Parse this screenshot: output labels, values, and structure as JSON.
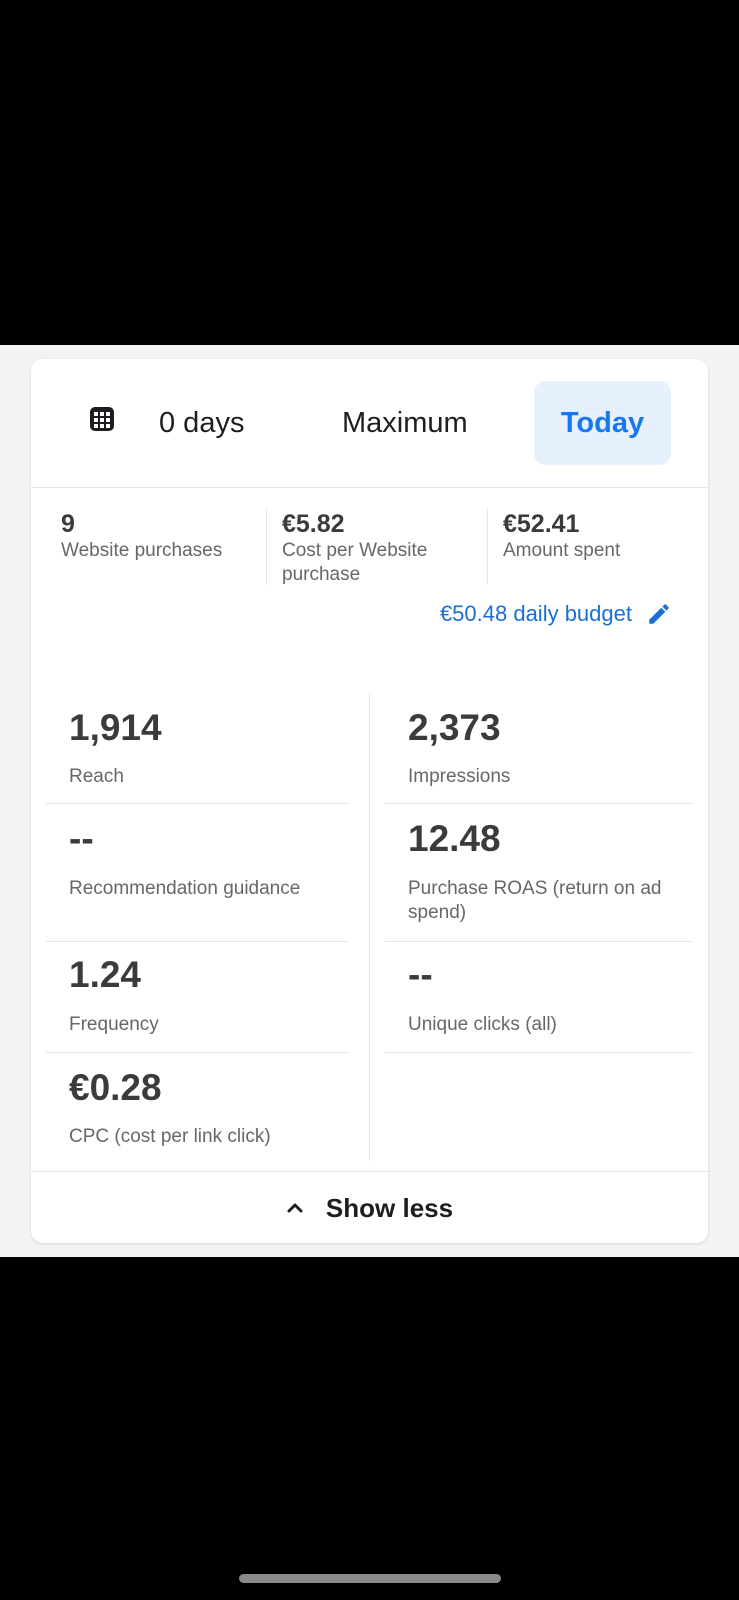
{
  "tabs": {
    "period_30": "0 days",
    "maximum": "Maximum",
    "today": "Today"
  },
  "summary": [
    {
      "value": "9",
      "label": "Website purchases"
    },
    {
      "value": "€5.82",
      "label": "Cost per Website purchase"
    },
    {
      "value": "€52.41",
      "label": "Amount spent"
    }
  ],
  "budget": {
    "label": "€50.48 daily budget"
  },
  "metrics": {
    "reach": {
      "value": "1,914",
      "label": "Reach"
    },
    "impressions": {
      "value": "2,373",
      "label": "Impressions"
    },
    "recommendation": {
      "value": "--",
      "label": "Recommendation guidance"
    },
    "roas": {
      "value": "12.48",
      "label": "Purchase ROAS (return on ad spend)"
    },
    "frequency": {
      "value": "1.24",
      "label": "Frequency"
    },
    "unique_clicks": {
      "value": "--",
      "label": "Unique clicks (all)"
    },
    "cpc": {
      "value": "€0.28",
      "label": "CPC (cost per link click)"
    }
  },
  "footer": {
    "show_less": "Show less"
  },
  "colors": {
    "accent": "#1877f2",
    "accent_bg": "#e7f0fd",
    "budget_blue": "#1a6fd6"
  }
}
